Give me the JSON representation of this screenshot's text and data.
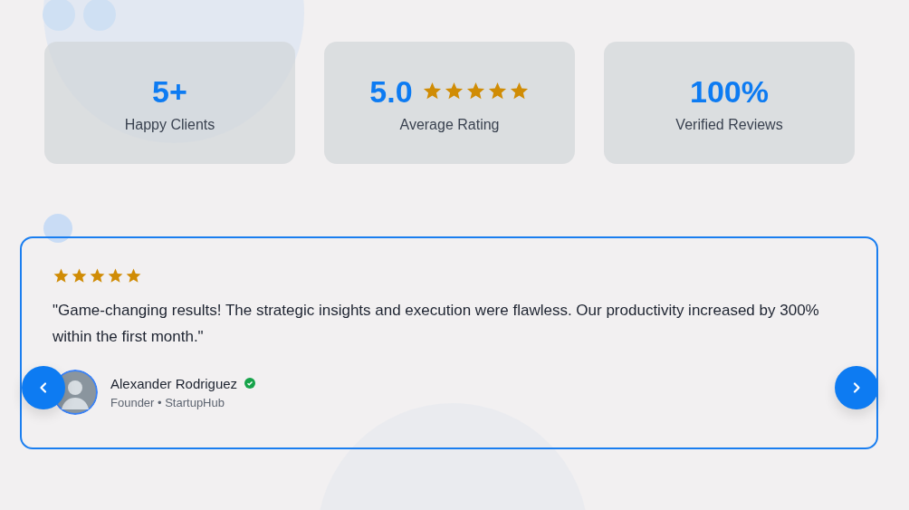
{
  "stats": [
    {
      "value": "5+",
      "label": "Happy Clients"
    },
    {
      "value": "5.0",
      "stars": 5,
      "label": "Average Rating"
    },
    {
      "value": "100%",
      "label": "Verified Reviews"
    }
  ],
  "testimonial": {
    "stars": 5,
    "quote": "\"Game-changing results! The strategic insights and execution were flawless. Our productivity increased by 300% within the first month.\"",
    "name": "Alexander Rodriguez",
    "verified": true,
    "role": "Founder • StartupHub"
  }
}
